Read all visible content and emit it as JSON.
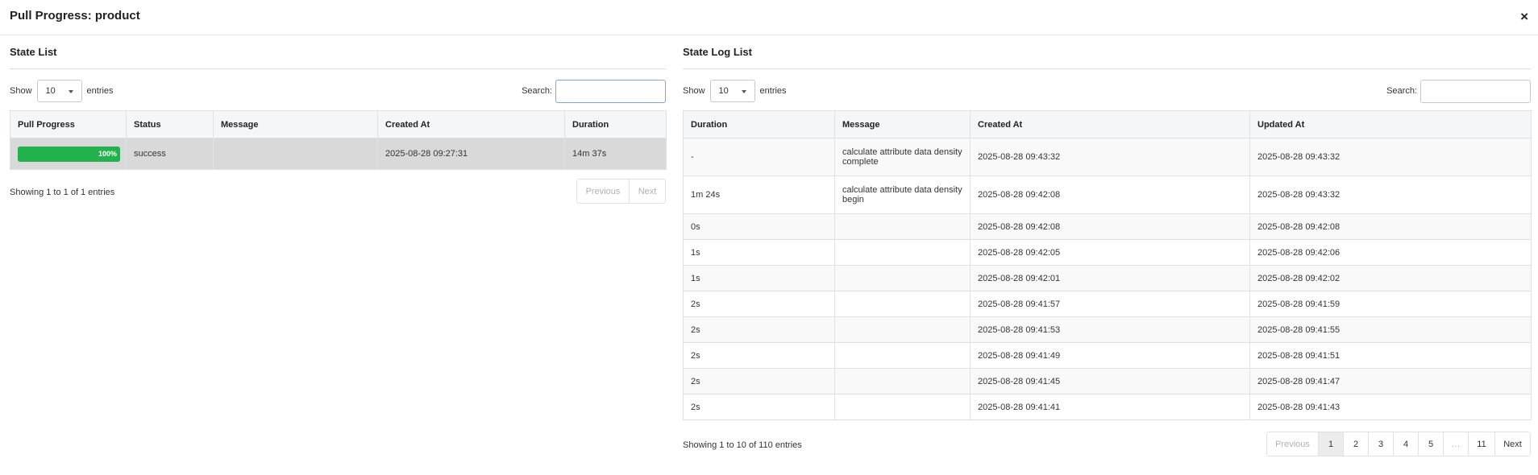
{
  "modal": {
    "title": "Pull Progress: product",
    "close_glyph": "×"
  },
  "state_list": {
    "title": "State List",
    "length": {
      "show_label": "Show",
      "value": "10",
      "entries_label": "entries"
    },
    "search": {
      "label": "Search:",
      "value": "",
      "placeholder": ""
    },
    "columns": [
      "Pull Progress",
      "Status",
      "Message",
      "Created At",
      "Duration"
    ],
    "rows": [
      {
        "progress": 1.0,
        "progress_label": "100%",
        "status": "success",
        "message": "",
        "created_at": "2025-08-28 09:27:31",
        "duration": "14m 37s"
      }
    ],
    "info": "Showing 1 to 1 of 1 entries",
    "pager": {
      "previous": "Previous",
      "next": "Next"
    }
  },
  "state_log_list": {
    "title": "State Log List",
    "length": {
      "show_label": "Show",
      "value": "10",
      "entries_label": "entries"
    },
    "search": {
      "label": "Search:",
      "value": "",
      "placeholder": ""
    },
    "columns": [
      "Duration",
      "Message",
      "Created At",
      "Updated At"
    ],
    "rows": [
      {
        "duration": "-",
        "message": "calculate attribute data density complete",
        "created_at": "2025-08-28 09:43:32",
        "updated_at": "2025-08-28 09:43:32"
      },
      {
        "duration": "1m 24s",
        "message": "calculate attribute data density begin",
        "created_at": "2025-08-28 09:42:08",
        "updated_at": "2025-08-28 09:43:32"
      },
      {
        "duration": "0s",
        "message": "",
        "created_at": "2025-08-28 09:42:08",
        "updated_at": "2025-08-28 09:42:08"
      },
      {
        "duration": "1s",
        "message": "",
        "created_at": "2025-08-28 09:42:05",
        "updated_at": "2025-08-28 09:42:06"
      },
      {
        "duration": "1s",
        "message": "",
        "created_at": "2025-08-28 09:42:01",
        "updated_at": "2025-08-28 09:42:02"
      },
      {
        "duration": "2s",
        "message": "",
        "created_at": "2025-08-28 09:41:57",
        "updated_at": "2025-08-28 09:41:59"
      },
      {
        "duration": "2s",
        "message": "",
        "created_at": "2025-08-28 09:41:53",
        "updated_at": "2025-08-28 09:41:55"
      },
      {
        "duration": "2s",
        "message": "",
        "created_at": "2025-08-28 09:41:49",
        "updated_at": "2025-08-28 09:41:51"
      },
      {
        "duration": "2s",
        "message": "",
        "created_at": "2025-08-28 09:41:45",
        "updated_at": "2025-08-28 09:41:47"
      },
      {
        "duration": "2s",
        "message": "",
        "created_at": "2025-08-28 09:41:41",
        "updated_at": "2025-08-28 09:41:43"
      }
    ],
    "info": "Showing 1 to 10 of 110 entries",
    "pager": {
      "previous": "Previous",
      "pages": [
        "1",
        "2",
        "3",
        "4",
        "5",
        "…",
        "11"
      ],
      "active_page": "1",
      "next": "Next"
    }
  },
  "colors": {
    "progress": "#22b14c",
    "selected_row": "#d9d9d9",
    "header_bg": "#f5f6f8"
  }
}
